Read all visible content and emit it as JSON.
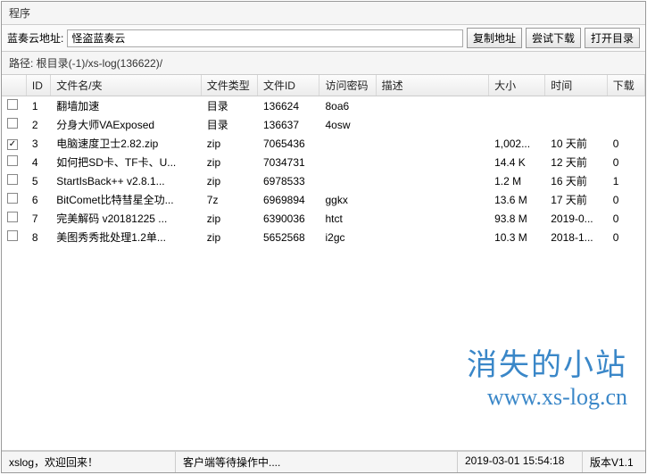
{
  "window_title": "程序",
  "address": {
    "label": "蓝奏云地址:",
    "value": "怪盗蓝奏云",
    "btn_copy": "复制地址",
    "btn_try": "尝试下载",
    "btn_open": "打开目录"
  },
  "path": {
    "label": "路径: ",
    "value": "根目录(-1)/xs-log(136622)/"
  },
  "headers": {
    "id": "ID",
    "name": "文件名/夹",
    "type": "文件类型",
    "fid": "文件ID",
    "pwd": "访问密码",
    "desc": "描述",
    "size": "大小",
    "time": "时间",
    "dl": "下载"
  },
  "rows": [
    {
      "chk": false,
      "id": "1",
      "name": "翻墙加速",
      "type": "目录",
      "fid": "136624",
      "pwd": "8oa6",
      "size": "",
      "time": "",
      "dl": ""
    },
    {
      "chk": false,
      "id": "2",
      "name": "分身大师VAExposed",
      "type": "目录",
      "fid": "136637",
      "pwd": "4osw",
      "size": "",
      "time": "",
      "dl": ""
    },
    {
      "chk": true,
      "id": "3",
      "name": "电脑速度卫士2.82.zip",
      "type": "zip",
      "fid": "7065436",
      "pwd": "",
      "size": "1,002...",
      "time": "10 天前",
      "dl": "0"
    },
    {
      "chk": false,
      "id": "4",
      "name": "如何把SD卡、TF卡、U...",
      "type": "zip",
      "fid": "7034731",
      "pwd": "",
      "size": "14.4 K",
      "time": "12 天前",
      "dl": "0"
    },
    {
      "chk": false,
      "id": "5",
      "name": "StartIsBack++ v2.8.1...",
      "type": "zip",
      "fid": "6978533",
      "pwd": "",
      "size": "1.2 M",
      "time": "16 天前",
      "dl": "1"
    },
    {
      "chk": false,
      "id": "6",
      "name": "BitComet比特彗星全功...",
      "type": "7z",
      "fid": "6969894",
      "pwd": "ggkx",
      "size": "13.6 M",
      "time": "17 天前",
      "dl": "0"
    },
    {
      "chk": false,
      "id": "7",
      "name": "完美解码 v20181225 ...",
      "type": "zip",
      "fid": "6390036",
      "pwd": "htct",
      "size": "93.8 M",
      "time": "2019-0...",
      "dl": "0"
    },
    {
      "chk": false,
      "id": "8",
      "name": "美图秀秀批处理1.2单...",
      "type": "zip",
      "fid": "5652568",
      "pwd": "i2gc",
      "size": "10.3 M",
      "time": "2018-1...",
      "dl": "0"
    }
  ],
  "watermark": {
    "title": "消失的小站",
    "url": "www.xs-log.cn"
  },
  "status": {
    "welcome": "xslog，欢迎回来！",
    "message": "客户端等待操作中....",
    "time": "2019-03-01 15:54:18",
    "version": "版本V1.1"
  }
}
